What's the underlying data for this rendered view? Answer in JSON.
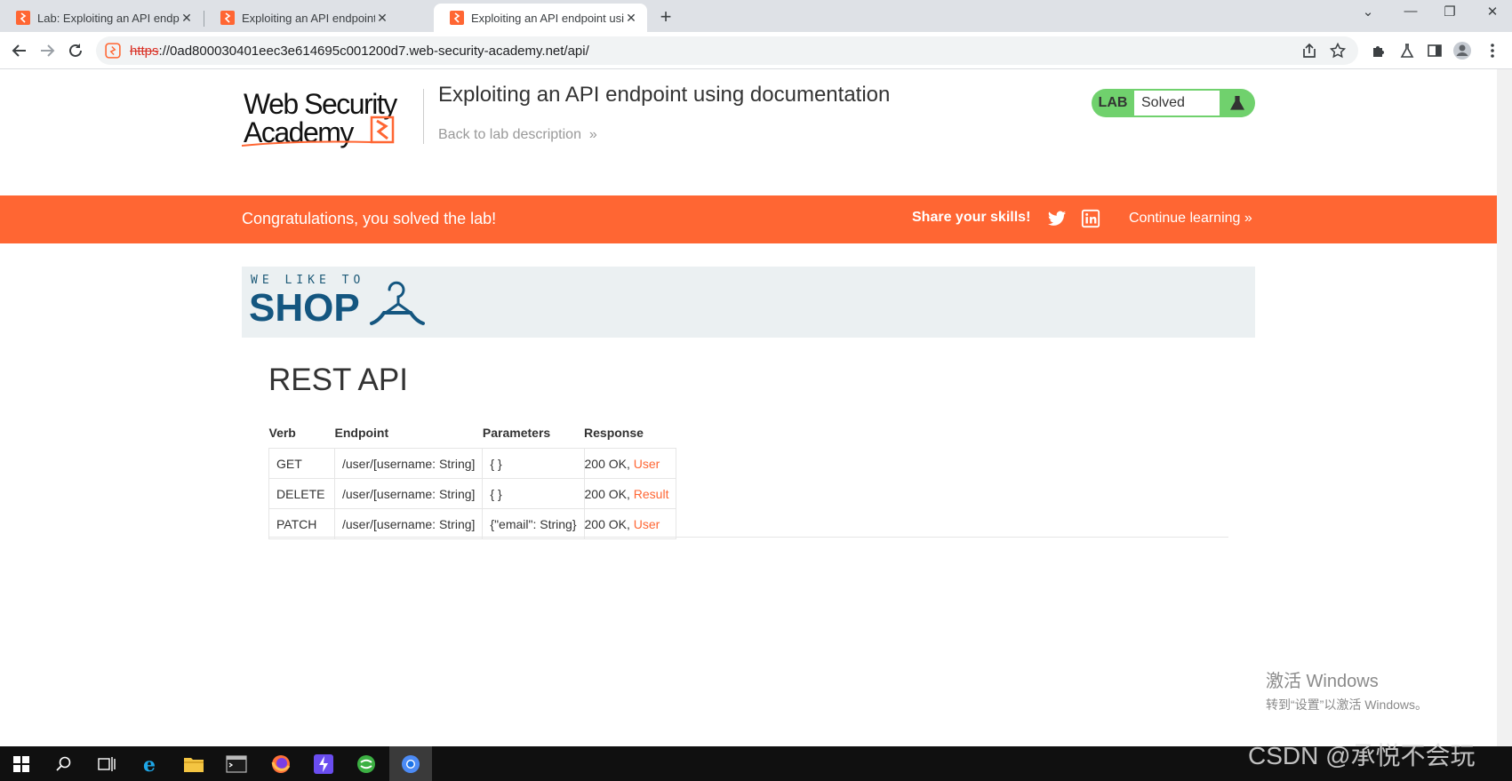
{
  "browser": {
    "tabs": [
      {
        "title": "Lab: Exploiting an API endpoint using documentation",
        "active": false
      },
      {
        "title": "Exploiting an API endpoint using documentation",
        "active": false
      },
      {
        "title": "Exploiting an API endpoint using documentation",
        "active": true
      }
    ],
    "url_scheme": "https",
    "url_rest": "://0ad800030401eec3e614695c001200d7.web-security-academy.net/api/"
  },
  "header": {
    "logo_line1": "Web Security",
    "logo_line2": "Academy",
    "lab_title": "Exploiting an API endpoint using documentation",
    "back_link": "Back to lab description",
    "lab_label": "LAB",
    "status": "Solved"
  },
  "banner": {
    "congrats": "Congratulations, you solved the lab!",
    "share": "Share your skills!",
    "continue": "Continue learning"
  },
  "shop": {
    "tagline": "WE LIKE TO",
    "word": "SHOP"
  },
  "api": {
    "title": "REST API",
    "headers": [
      "Verb",
      "Endpoint",
      "Parameters",
      "Response"
    ],
    "rows": [
      {
        "verb": "GET",
        "endpoint": "/user/[username: String]",
        "params": "{ }",
        "status": "200 OK, ",
        "link": "User"
      },
      {
        "verb": "DELETE",
        "endpoint": "/user/[username: String]",
        "params": "{ }",
        "status": "200 OK, ",
        "link": "Result"
      },
      {
        "verb": "PATCH",
        "endpoint": "/user/[username: String]",
        "params": "{\"email\": String}",
        "status": "200 OK, ",
        "link": "User"
      }
    ]
  },
  "watermark": {
    "line1": "激活 Windows",
    "line2": "转到“设置”以激活 Windows。"
  },
  "overlay": {
    "csdn": "CSDN @承悦不会玩"
  },
  "colors": {
    "accent_orange": "#ff6633",
    "lab_green": "#70d16d",
    "shop_blue": "#145680"
  }
}
